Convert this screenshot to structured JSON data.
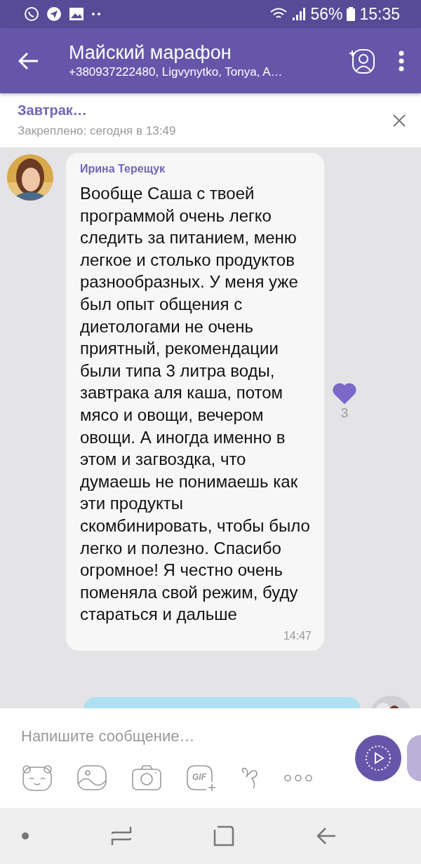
{
  "status_bar": {
    "battery": "56%",
    "time": "15:35"
  },
  "header": {
    "title": "Майский марафон",
    "subtitle": "+380937222480, Ligvynytko, Tonya, A…"
  },
  "pinned": {
    "title": "Завтрак…",
    "meta": "Закреплено: сегодня в 13:49"
  },
  "messages": [
    {
      "kind": "incoming",
      "sender": "Ирина Терещук",
      "text": "Вообще Саша с твоей программой очень легко следить за питанием, меню легкое и столько продуктов разнообразных. У меня уже был опыт общения с диетологами не очень приятный, рекомендации были типа 3 литра воды, завтрака аля каша, потом мясо и овощи, вечером овощи. А иногда именно в этом и загвоздка, что думаешь не понимаешь как эти продукты скомбинировать, чтобы было легко и полезно. Спасибо огромное! Я честно очень поменяла свой режим, буду стараться и дальше",
      "time": "14:47",
      "likes": "3",
      "liked": true
    },
    {
      "kind": "outgoing"
    }
  ],
  "composer": {
    "placeholder": "Напишите сообщение…",
    "gif_label": "GIF"
  }
}
